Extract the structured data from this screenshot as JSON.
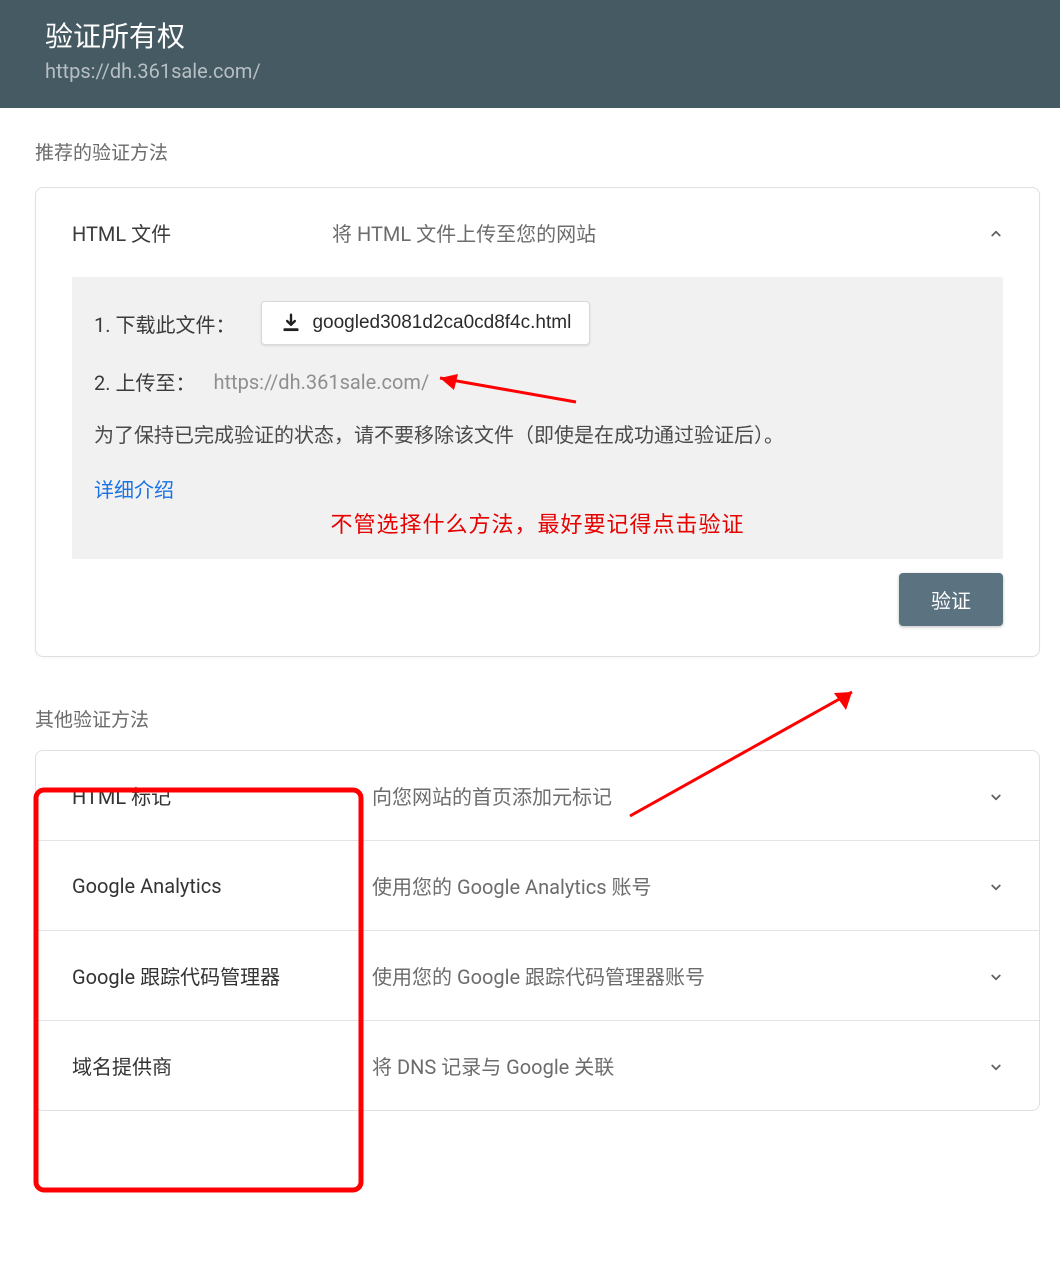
{
  "header": {
    "title": "验证所有权",
    "url": "https://dh.361sale.com/"
  },
  "recommended": {
    "section_label": "推荐的验证方法",
    "method_title": "HTML 文件",
    "method_subtitle": "将 HTML 文件上传至您的网站",
    "step1_label": "1. 下载此文件：",
    "download_filename": "googled3081d2ca0cd8f4c.html",
    "step2_label": "2. 上传至：",
    "upload_url": "https://dh.361sale.com/",
    "notice": "为了保持已完成验证的状态，请不要移除该文件（即使是在成功通过验证后）。",
    "detail_link": "详细介绍",
    "red_annotation": "不管选择什么方法，最好要记得点击验证",
    "verify_button": "验证"
  },
  "other": {
    "section_label": "其他验证方法",
    "methods": [
      {
        "title": "HTML 标记",
        "desc": "向您网站的首页添加元标记"
      },
      {
        "title": "Google Analytics",
        "desc": "使用您的 Google Analytics 账号"
      },
      {
        "title": "Google 跟踪代码管理器",
        "desc": "使用您的 Google 跟踪代码管理器账号"
      },
      {
        "title": "域名提供商",
        "desc": "将 DNS 记录与 Google 关联"
      }
    ]
  }
}
